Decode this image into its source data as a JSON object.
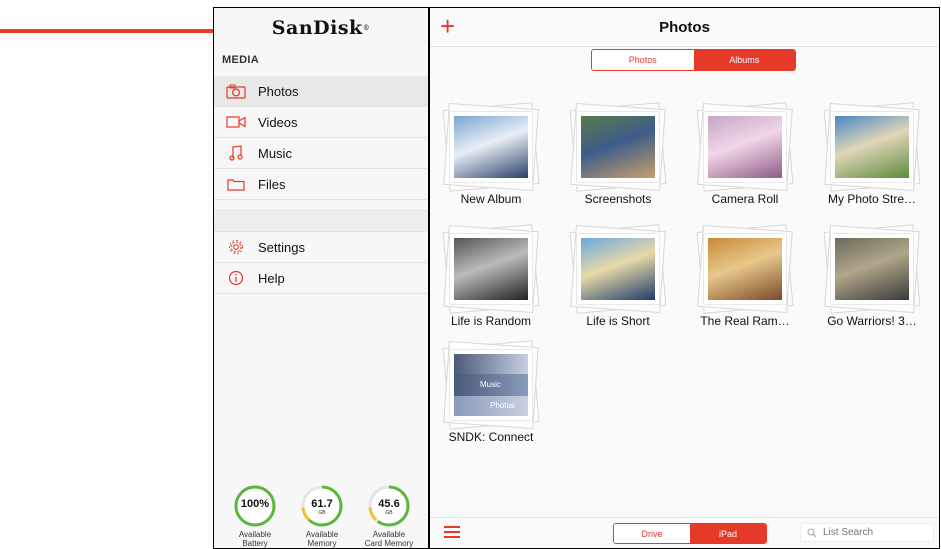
{
  "brand": {
    "logo": "SanDisk",
    "tm": "®"
  },
  "sidebar": {
    "section": "MEDIA",
    "items": [
      {
        "label": "Photos",
        "icon": "camera-icon"
      },
      {
        "label": "Videos",
        "icon": "video-icon"
      },
      {
        "label": "Music",
        "icon": "music-icon"
      },
      {
        "label": "Files",
        "icon": "folder-icon"
      }
    ],
    "items2": [
      {
        "label": "Settings",
        "icon": "gear-icon"
      },
      {
        "label": "Help",
        "icon": "info-icon"
      }
    ]
  },
  "gauges": [
    {
      "value": "100%",
      "unit": "",
      "caption1": "Available",
      "caption2": "Battery",
      "level": 1.0
    },
    {
      "value": "61.7",
      "unit": "GB",
      "caption1": "Available",
      "caption2": "Memory",
      "level": 0.65
    },
    {
      "value": "45.6",
      "unit": "GB",
      "caption1": "Available",
      "caption2": "Card Memory",
      "level": 0.6
    }
  ],
  "header": {
    "title": "Photos",
    "add_icon": "plus-icon"
  },
  "tabs": {
    "left": "Photos",
    "right": "Albums",
    "selected": "Albums"
  },
  "albums": [
    {
      "label": "New Album",
      "colors": [
        "#7aa6cf",
        "#2a3f66",
        "#e8eef6"
      ]
    },
    {
      "label": "Screenshots",
      "colors": [
        "#5a7a4a",
        "#c9a06b",
        "#3d5c8a"
      ]
    },
    {
      "label": "Camera Roll",
      "colors": [
        "#c7a5c4",
        "#8e5c84",
        "#f0d6e8"
      ]
    },
    {
      "label": "My Photo Stre…",
      "colors": [
        "#4a86c4",
        "#5d8a3c",
        "#e0d6b8"
      ]
    },
    {
      "label": "Life is Random",
      "colors": [
        "#555555",
        "#222222",
        "#bbbbbb"
      ]
    },
    {
      "label": "Life is Short",
      "colors": [
        "#6aa8e0",
        "#1d3b6a",
        "#e8d9a8"
      ]
    },
    {
      "label": "The Real Ram…",
      "colors": [
        "#c98a3a",
        "#7a4a2a",
        "#e8c78a"
      ]
    },
    {
      "label": "Go Warriors! 3…",
      "colors": [
        "#6a6a5a",
        "#3a3a3a",
        "#b0a68a"
      ]
    },
    {
      "label": "SNDK: Connect",
      "colors": [
        "#4a5a7a",
        "#8a9ab8",
        "#c8d0e0"
      ],
      "lines": [
        "Music",
        "Photos"
      ]
    }
  ],
  "bottom": {
    "menu_icon": "hamburger-icon",
    "left": "Drive",
    "right": "iPad",
    "selected": "iPad",
    "search_placeholder": "List Search",
    "search_icon": "search-icon"
  },
  "colors": {
    "accent": "#e53a2a",
    "arrow": "#ee3a22"
  }
}
